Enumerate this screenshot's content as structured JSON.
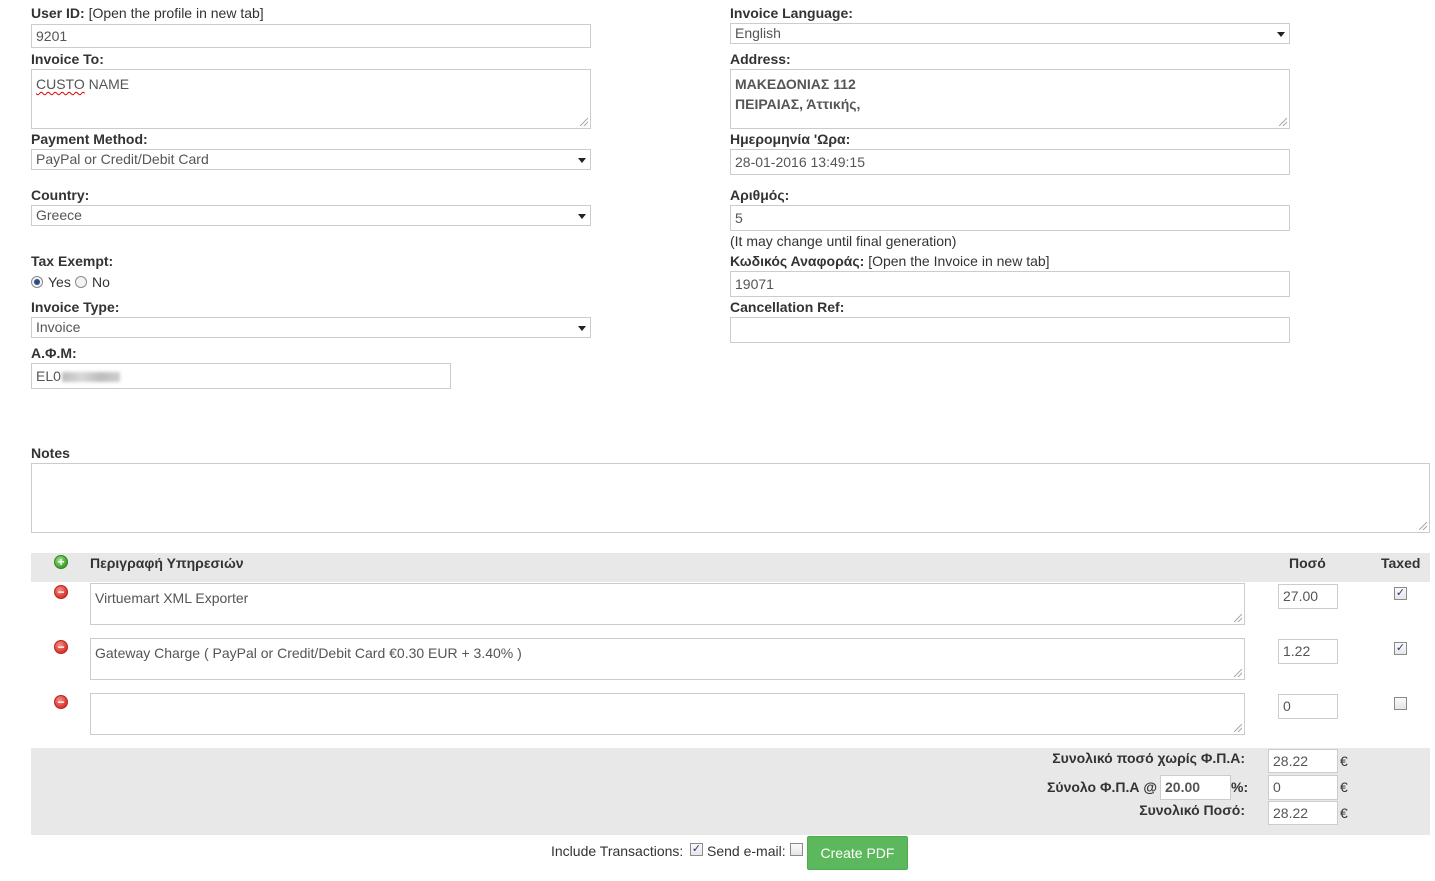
{
  "left": {
    "user_id_label": "User ID:",
    "user_id_link": "[Open the profile in new tab]",
    "user_id_value": "9201",
    "invoice_to_label": "Invoice To:",
    "invoice_to_value_a": "CUSTO",
    "invoice_to_value_b": " NAME",
    "payment_method_label": "Payment Method:",
    "payment_method_value": "PayPal or Credit/Debit Card",
    "country_label": "Country:",
    "country_value": "Greece",
    "tax_exempt_label": "Tax Exempt:",
    "tax_exempt_yes": "Yes",
    "tax_exempt_no": "No",
    "tax_exempt_selected": "Yes",
    "invoice_type_label": "Invoice Type:",
    "invoice_type_value": "Invoice",
    "afm_label": "Α.Φ.Μ:",
    "afm_value": "EL0"
  },
  "right": {
    "invoice_language_label": "Invoice Language:",
    "invoice_language_value": "English",
    "address_label": "Address:",
    "address_line1": "ΜΑΚΕΔΟΝΙΑΣ 112",
    "address_line2": "ΠΕΙΡΑΙΑΣ, Άττικής,",
    "datetime_label": "Ημερομηνία 'Ωρα:",
    "datetime_value": "28-01-2016 13:49:15",
    "number_label": "Αριθμός:",
    "number_value": "5",
    "number_note": "(It may change until final generation)",
    "ref_code_label": "Κωδικός Αναφοράς:",
    "ref_code_link": "[Open the Invoice in new tab]",
    "ref_code_value": "19071",
    "cancellation_label": "Cancellation Ref:",
    "cancellation_value": ""
  },
  "notes": {
    "label": "Notes",
    "value": ""
  },
  "items": {
    "header_description": "Περιγραφή Υπηρεσιών",
    "header_amount": "Ποσό",
    "header_taxed": "Taxed",
    "rows": [
      {
        "description": "Virtuemart XML Exporter",
        "amount": "27.00",
        "taxed": true
      },
      {
        "description": "Gateway Charge ( PayPal or Credit/Debit Card €0.30  EUR + 3.40% )",
        "amount": "1.22",
        "taxed": true
      },
      {
        "description": "",
        "amount": "0",
        "taxed": false
      }
    ]
  },
  "totals": {
    "subtotal_label": "Συνολικό ποσό χωρίς Φ.Π.Α:",
    "subtotal_value": "28.22",
    "vat_label": "Σύνολο Φ.Π.Α @",
    "vat_rate": "20.00",
    "vat_pct": "%:",
    "vat_value": "0",
    "total_label": "Συνολικό Ποσό:",
    "total_value": "28.22",
    "currency": "€"
  },
  "footer": {
    "include_transactions_label": "Include Transactions:",
    "include_transactions_checked": true,
    "send_email_label": "Send e-mail:",
    "send_email_checked": false,
    "create_pdf_label": "Create PDF"
  },
  "colors": {
    "button_green": "#5cb85c",
    "panel_gray": "#e8e8e8",
    "remove_red": "#d9342b",
    "add_green": "#3fa12e"
  },
  "icons": [
    "add-row-icon",
    "remove-row-icon",
    "dropdown-arrow-icon",
    "resize-grip-icon",
    "checkmark-icon"
  ]
}
